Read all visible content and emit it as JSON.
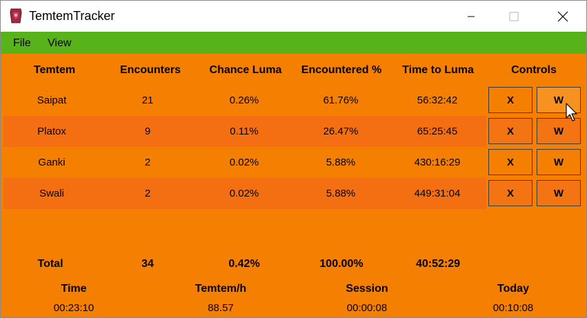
{
  "window": {
    "title": "TemtemTracker",
    "icon": "temtem-app-icon"
  },
  "menu": {
    "items": [
      {
        "label": "File"
      },
      {
        "label": "View"
      }
    ]
  },
  "table": {
    "headers": [
      "Temtem",
      "Encounters",
      "Chance Luma",
      "Encountered %",
      "Time to Luma",
      "Controls"
    ],
    "rows": [
      {
        "name": "Saipat",
        "encounters": "21",
        "chance_luma": "0.26%",
        "encountered_pct": "61.76%",
        "time_to_luma": "56:32:42",
        "x_label": "X",
        "w_label": "W"
      },
      {
        "name": "Platox",
        "encounters": "9",
        "chance_luma": "0.11%",
        "encountered_pct": "26.47%",
        "time_to_luma": "65:25:45",
        "x_label": "X",
        "w_label": "W"
      },
      {
        "name": "Ganki",
        "encounters": "2",
        "chance_luma": "0.02%",
        "encountered_pct": "5.88%",
        "time_to_luma": "430:16:29",
        "x_label": "X",
        "w_label": "W"
      },
      {
        "name": "Swali",
        "encounters": "2",
        "chance_luma": "0.02%",
        "encountered_pct": "5.88%",
        "time_to_luma": "449:31:04",
        "x_label": "X",
        "w_label": "W"
      }
    ],
    "total": {
      "label": "Total",
      "encounters": "34",
      "chance_luma": "0.42%",
      "encountered_pct": "100.00%",
      "time_to_luma": "40:52:29"
    }
  },
  "stats": [
    {
      "label": "Time",
      "value": "00:23:10"
    },
    {
      "label": "Temtem/h",
      "value": "88.57"
    },
    {
      "label": "Session",
      "value": "00:00:08"
    },
    {
      "label": "Today",
      "value": "00:10:08"
    }
  ],
  "colors": {
    "background": "#f57f00",
    "alt_row": "#f46f12",
    "menubar": "#58b31a",
    "titlebar": "#ffffff",
    "hover_button": "#f7911f"
  }
}
